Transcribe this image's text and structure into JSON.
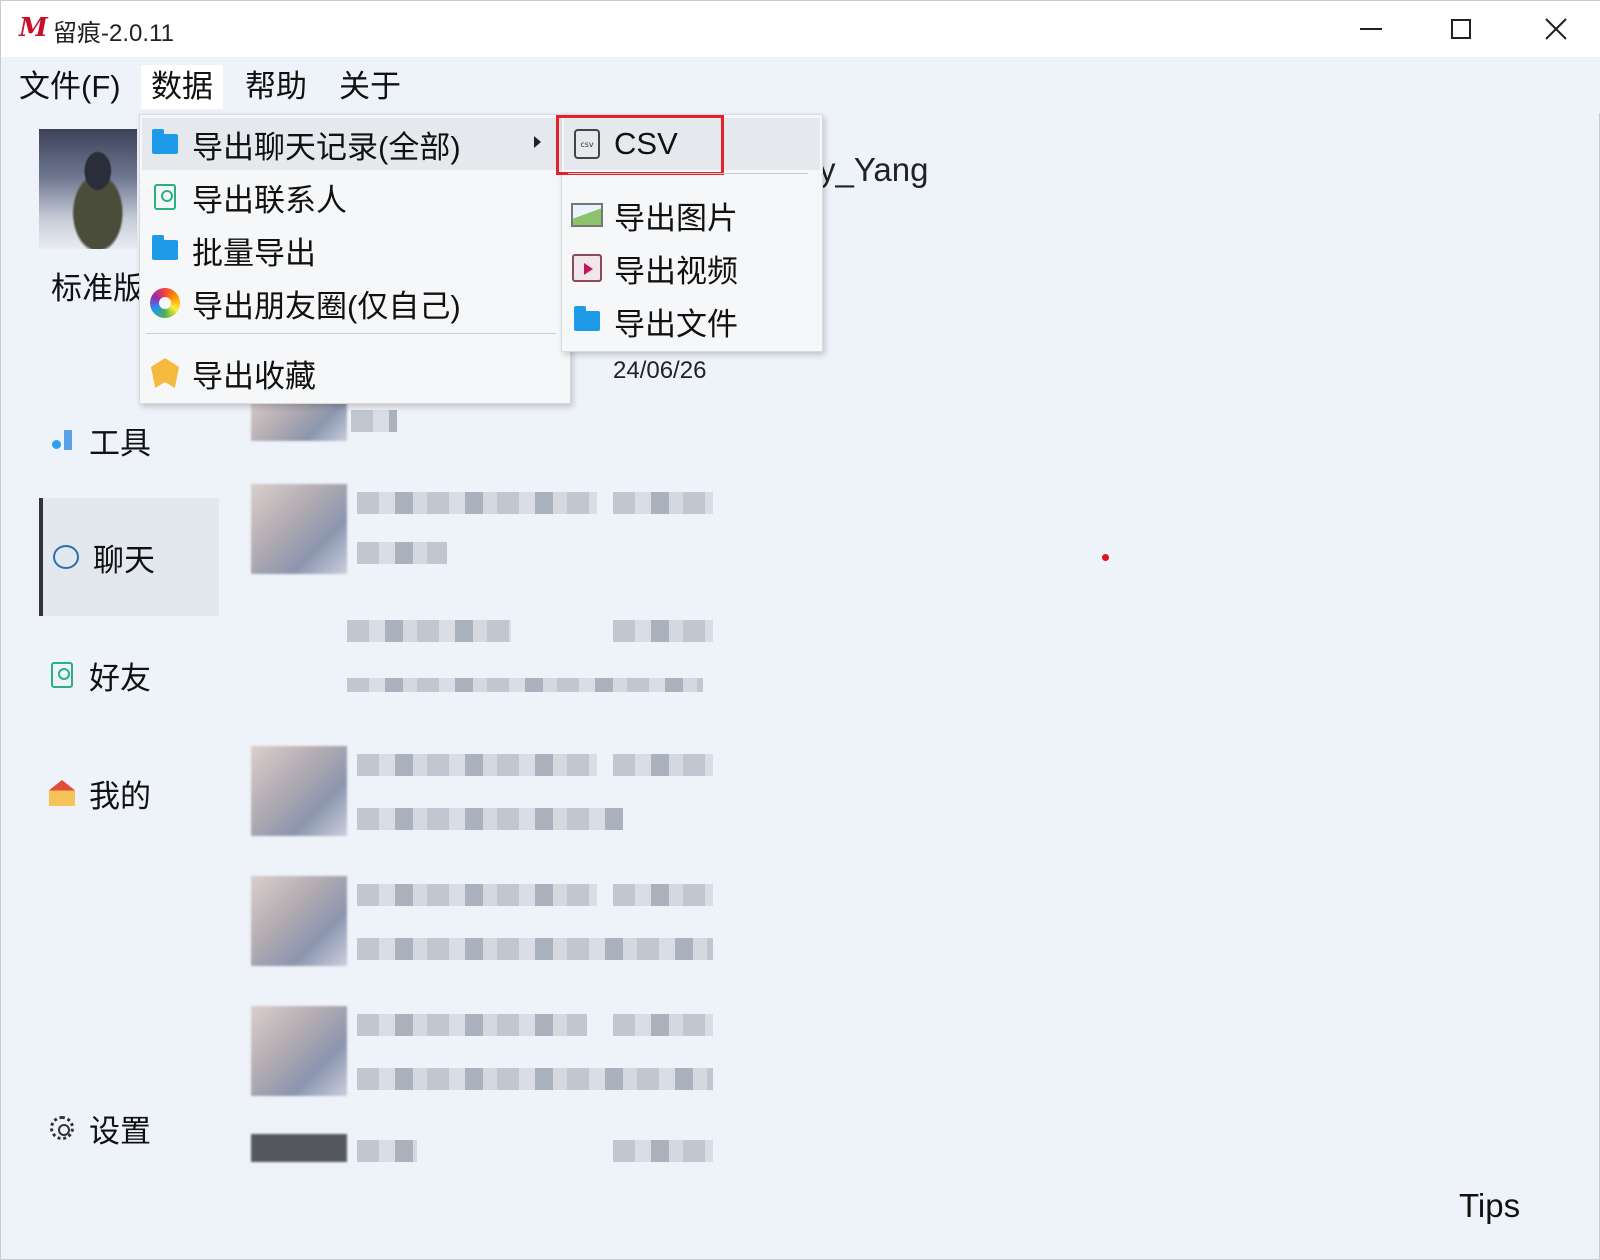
{
  "window": {
    "logo": "M",
    "title": "留痕-2.0.11"
  },
  "menubar": {
    "file": "文件(F)",
    "data": "数据",
    "help": "帮助",
    "about": "关于"
  },
  "profile": {
    "username_partial": "y_Yang",
    "edition": "标准版"
  },
  "sidebar": {
    "tools": "工具",
    "chat": "聊天",
    "friends": "好友",
    "mine": "我的",
    "settings": "设置"
  },
  "data_menu": {
    "export_chat": "导出聊天记录(全部)",
    "export_contacts": "导出联系人",
    "batch_export": "批量导出",
    "export_moments": "导出朋友圈(仅自己)",
    "export_favorites": "导出收藏"
  },
  "export_submenu": {
    "csv": "CSV",
    "images": "导出图片",
    "videos": "导出视频",
    "files": "导出文件"
  },
  "chat_list": {
    "first_date": "24/06/26"
  },
  "footer": {
    "tips": "Tips"
  },
  "icons": {
    "tools": "tools-icon",
    "chat": "chat-icon",
    "friends": "contacts-icon",
    "mine": "home-icon",
    "settings": "gear-icon"
  },
  "colors": {
    "highlight_box": "#e3222c",
    "folder": "#1e9be8",
    "background": "#eef3f9"
  }
}
